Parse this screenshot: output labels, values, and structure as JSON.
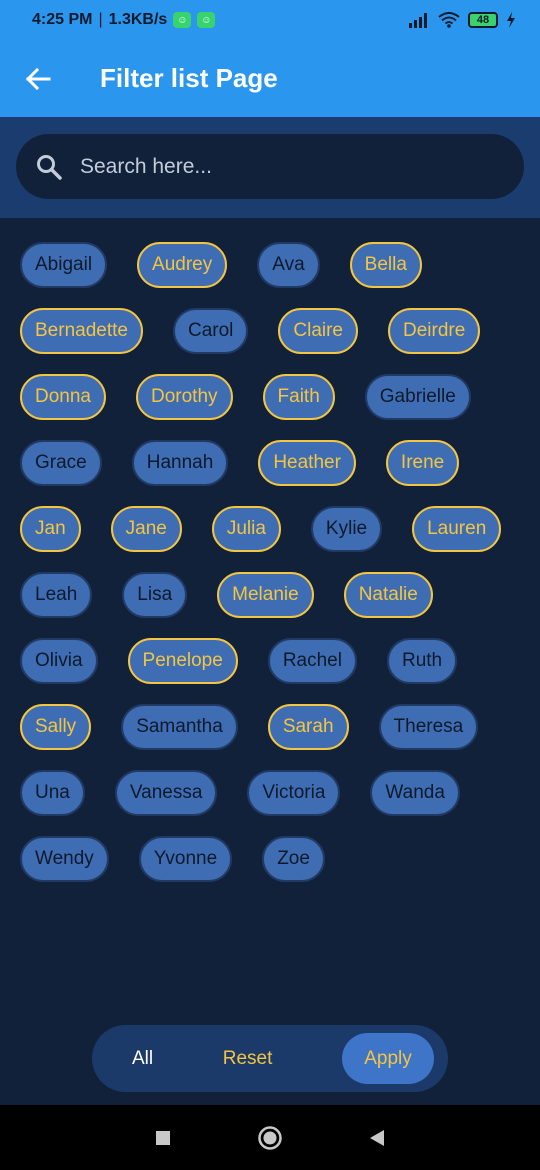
{
  "status": {
    "time": "4:25 PM",
    "separator": "|",
    "network_speed": "1.3KB/s",
    "battery": "48"
  },
  "app_bar": {
    "title": "Filter list Page"
  },
  "search": {
    "placeholder": "Search here..."
  },
  "chips": [
    {
      "label": "Abigail",
      "selected": false
    },
    {
      "label": "Audrey",
      "selected": true
    },
    {
      "label": "Ava",
      "selected": false
    },
    {
      "label": "Bella",
      "selected": true
    },
    {
      "label": "Bernadette",
      "selected": true
    },
    {
      "label": "Carol",
      "selected": false
    },
    {
      "label": "Claire",
      "selected": true
    },
    {
      "label": "Deirdre",
      "selected": true
    },
    {
      "label": "Donna",
      "selected": true
    },
    {
      "label": "Dorothy",
      "selected": true
    },
    {
      "label": "Faith",
      "selected": true
    },
    {
      "label": "Gabrielle",
      "selected": false
    },
    {
      "label": "Grace",
      "selected": false
    },
    {
      "label": "Hannah",
      "selected": false
    },
    {
      "label": "Heather",
      "selected": true
    },
    {
      "label": "Irene",
      "selected": true
    },
    {
      "label": "Jan",
      "selected": true
    },
    {
      "label": "Jane",
      "selected": true
    },
    {
      "label": "Julia",
      "selected": true
    },
    {
      "label": "Kylie",
      "selected": false
    },
    {
      "label": "Lauren",
      "selected": true
    },
    {
      "label": "Leah",
      "selected": false
    },
    {
      "label": "Lisa",
      "selected": false
    },
    {
      "label": "Melanie",
      "selected": true
    },
    {
      "label": "Natalie",
      "selected": true
    },
    {
      "label": "Olivia",
      "selected": false
    },
    {
      "label": "Penelope",
      "selected": true
    },
    {
      "label": "Rachel",
      "selected": false
    },
    {
      "label": "Ruth",
      "selected": false
    },
    {
      "label": "Sally",
      "selected": true
    },
    {
      "label": "Samantha",
      "selected": false
    },
    {
      "label": "Sarah",
      "selected": true
    },
    {
      "label": "Theresa",
      "selected": false
    },
    {
      "label": "Una",
      "selected": false
    },
    {
      "label": "Vanessa",
      "selected": false
    },
    {
      "label": "Victoria",
      "selected": false
    },
    {
      "label": "Wanda",
      "selected": false
    },
    {
      "label": "Wendy",
      "selected": false
    },
    {
      "label": "Yvonne",
      "selected": false
    },
    {
      "label": "Zoe",
      "selected": false
    }
  ],
  "actions": {
    "all_label": "All",
    "reset_label": "Reset",
    "apply_label": "Apply"
  },
  "colors": {
    "app_bar": "#2b96ee",
    "background": "#12213a",
    "chip": "#3f6db4",
    "selected_accent": "#f4c540"
  }
}
